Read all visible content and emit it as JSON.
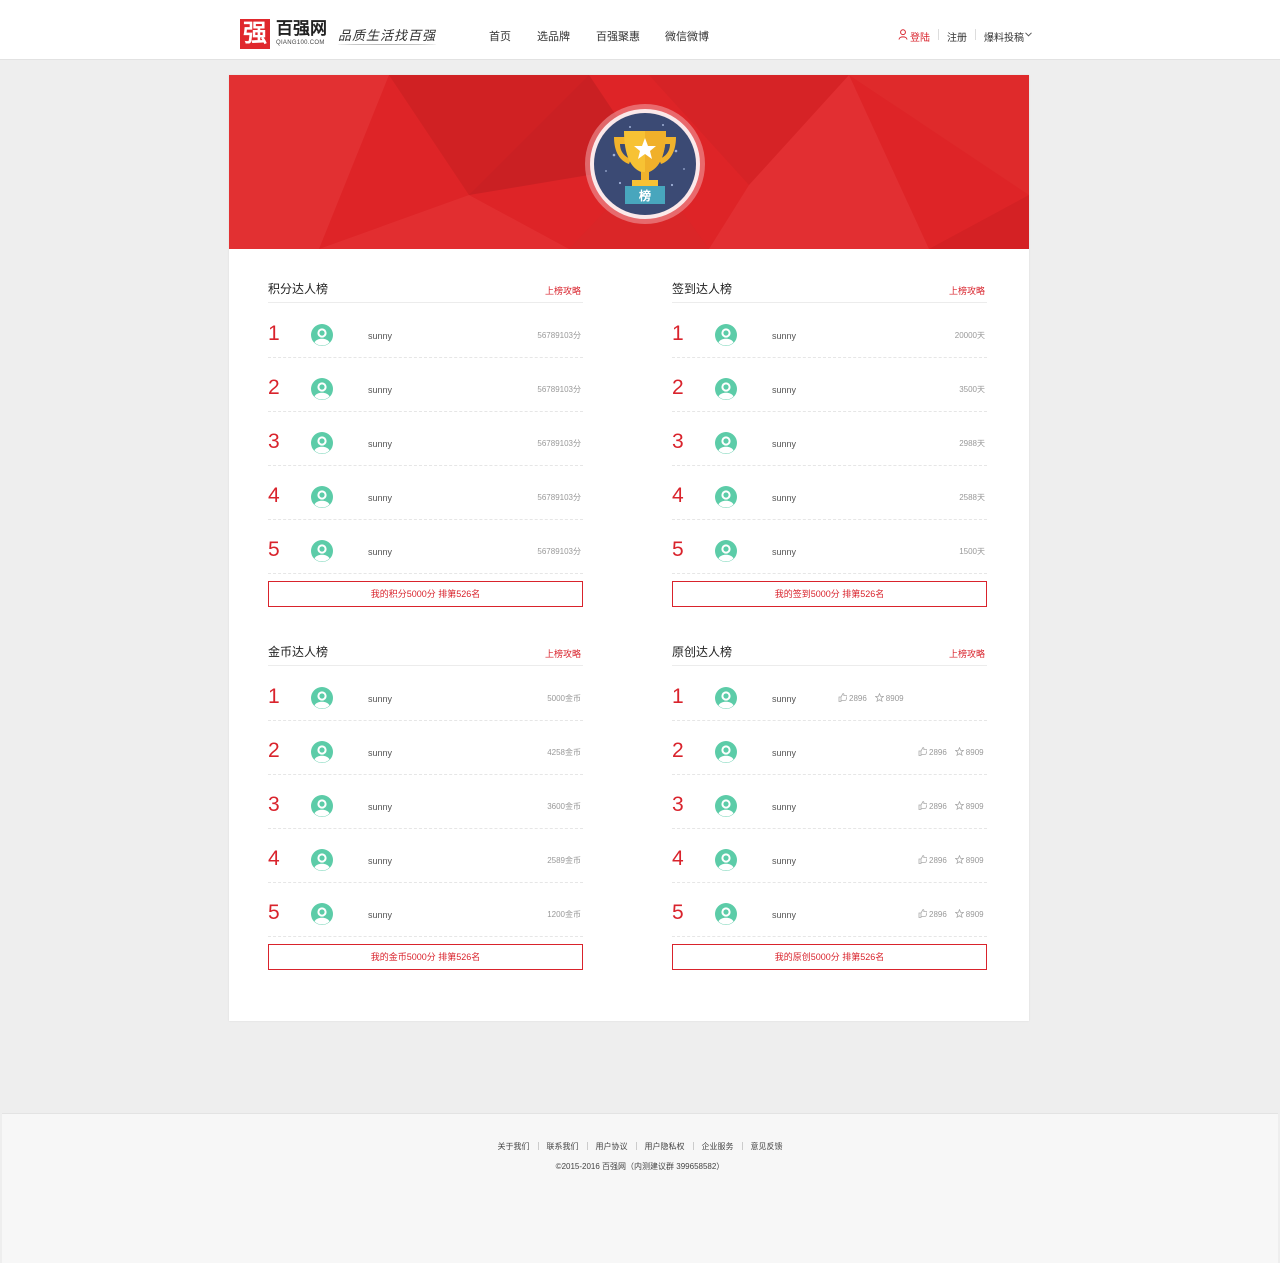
{
  "header": {
    "logo_char": "强",
    "logo_name": "百强网",
    "logo_domain": "QIANG100.COM",
    "slogan": "品质生活找百强",
    "nav": [
      "首页",
      "选品牌",
      "百强聚惠",
      "微信微博"
    ],
    "login": "登陆",
    "register": "注册",
    "submit": "爆料投稿"
  },
  "banner": {
    "badge_label": "榜"
  },
  "panels": [
    {
      "title": "积分达人榜",
      "link": "上榜攻略",
      "rows": [
        {
          "rank": "1",
          "name": "sunny",
          "score": "56789103分"
        },
        {
          "rank": "2",
          "name": "sunny",
          "score": "56789103分"
        },
        {
          "rank": "3",
          "name": "sunny",
          "score": "56789103分"
        },
        {
          "rank": "4",
          "name": "sunny",
          "score": "56789103分"
        },
        {
          "rank": "5",
          "name": "sunny",
          "score": "56789103分"
        }
      ],
      "my": "我的积分5000分 排第526名"
    },
    {
      "title": "签到达人榜",
      "link": "上榜攻略",
      "rows": [
        {
          "rank": "1",
          "name": "sunny",
          "score": "20000天"
        },
        {
          "rank": "2",
          "name": "sunny",
          "score": "3500天"
        },
        {
          "rank": "3",
          "name": "sunny",
          "score": "2988天"
        },
        {
          "rank": "4",
          "name": "sunny",
          "score": "2588天"
        },
        {
          "rank": "5",
          "name": "sunny",
          "score": "1500天"
        }
      ],
      "my": "我的签到5000分 排第526名"
    },
    {
      "title": "金币达人榜",
      "link": "上榜攻略",
      "rows": [
        {
          "rank": "1",
          "name": "sunny",
          "score": "5000金币"
        },
        {
          "rank": "2",
          "name": "sunny",
          "score": "4258金币"
        },
        {
          "rank": "3",
          "name": "sunny",
          "score": "3600金币"
        },
        {
          "rank": "4",
          "name": "sunny",
          "score": "2589金币"
        },
        {
          "rank": "5",
          "name": "sunny",
          "score": "1200金币"
        }
      ],
      "my": "我的金币5000分 排第526名"
    },
    {
      "title": "原创达人榜",
      "link": "上榜攻略",
      "rows": [
        {
          "rank": "1",
          "name": "sunny",
          "likes": "2896",
          "stars": "8909"
        },
        {
          "rank": "2",
          "name": "sunny",
          "likes": "2896",
          "stars": "8909"
        },
        {
          "rank": "3",
          "name": "sunny",
          "likes": "2896",
          "stars": "8909"
        },
        {
          "rank": "4",
          "name": "sunny",
          "likes": "2896",
          "stars": "8909"
        },
        {
          "rank": "5",
          "name": "sunny",
          "likes": "2896",
          "stars": "8909"
        }
      ],
      "my": "我的原创5000分 排第526名"
    }
  ],
  "footer": {
    "links": [
      "关于我们",
      "联系我们",
      "用户协议",
      "用户隐私权",
      "企业服务",
      "意见反馈"
    ],
    "copyright": "©2015-2016 百强网（内测建议群 399658582）"
  },
  "colors": {
    "accent": "#d9232c",
    "avatar": "#5ccca8",
    "badge_bg": "#3a4a72"
  },
  "icons": [
    "user-icon",
    "chevron-down-icon",
    "trophy-icon",
    "avatar-icon",
    "thumb-up-icon",
    "star-icon"
  ]
}
